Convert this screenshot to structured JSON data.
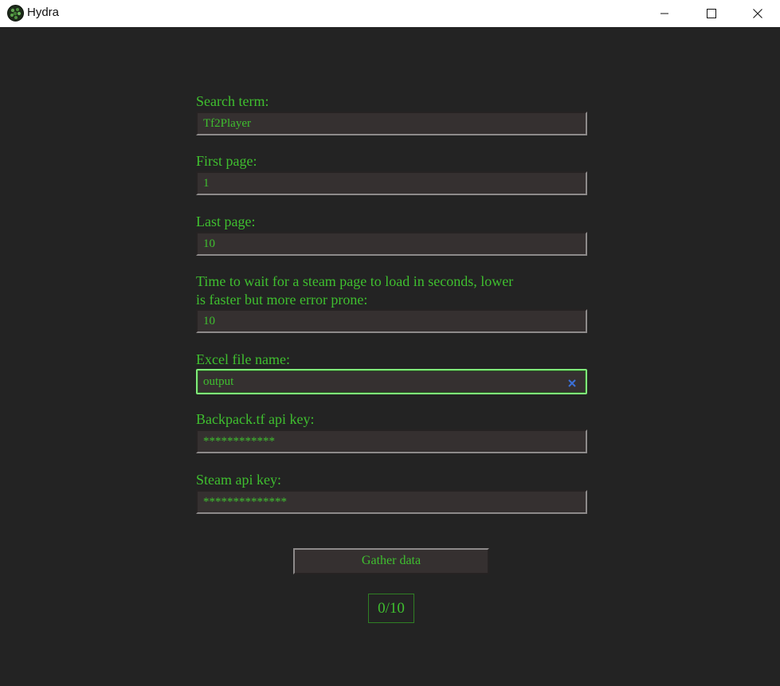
{
  "window": {
    "title": "Hydra",
    "icon": "hydra-logo-icon",
    "controls": [
      "minimize-icon",
      "maximize-icon",
      "close-icon"
    ]
  },
  "colors": {
    "background": "#232323",
    "text_accent": "#3fbf2f",
    "field_bg": "#353030",
    "focus_border": "#7fea7a",
    "clear_icon": "#3b6fd6"
  },
  "form": {
    "search_term": {
      "label": "Search term:",
      "value": "Tf2Player"
    },
    "first_page": {
      "label": "First page:",
      "value": "1"
    },
    "last_page": {
      "label": "Last page:",
      "value": "10"
    },
    "wait_time": {
      "label_line1": "Time to wait for a steam page to load in seconds, lower",
      "label_line2": "is faster but more error prone:",
      "value": "10"
    },
    "excel_file": {
      "label": "Excel file name:",
      "value": "output",
      "focused": true,
      "clear_icon": "clear-x-icon"
    },
    "backpack_key": {
      "label": "Backpack.tf api key:",
      "value": "************"
    },
    "steam_key": {
      "label": "Steam api key:",
      "value": "**************"
    }
  },
  "actions": {
    "gather_label": "Gather data"
  },
  "progress": {
    "text": "0/10"
  }
}
